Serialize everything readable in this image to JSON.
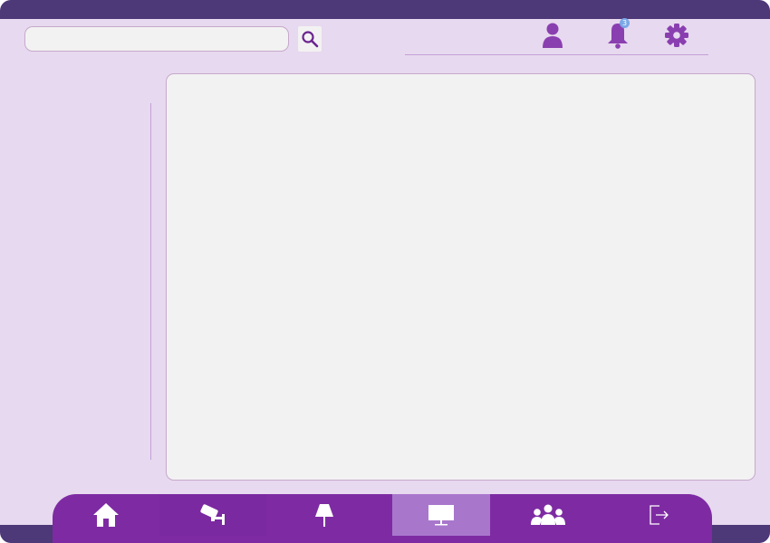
{
  "search": {
    "value": "",
    "placeholder": ""
  },
  "header": {
    "icons": [
      "search-icon",
      "user-icon",
      "bell-icon",
      "gear-icon"
    ],
    "notifications_count": "3"
  },
  "bottom_nav": {
    "items": [
      {
        "name": "home",
        "icon": "home-icon",
        "active": false
      },
      {
        "name": "camera",
        "icon": "security-camera-icon",
        "active": false
      },
      {
        "name": "lamp",
        "icon": "lamp-icon",
        "active": false
      },
      {
        "name": "monitor",
        "icon": "monitor-icon",
        "active": true
      },
      {
        "name": "users",
        "icon": "users-icon",
        "active": false
      },
      {
        "name": "logout",
        "icon": "logout-icon",
        "active": false
      }
    ]
  },
  "colors": {
    "frame_background": "#e7d9ef",
    "top_bar": "#4d3878",
    "accent_purple": "#8a3fb0",
    "nav_background": "#7e2ba3",
    "nav_active": "#a877cc",
    "panel_background": "#f2f2f2",
    "badge": "#79a8e6"
  }
}
